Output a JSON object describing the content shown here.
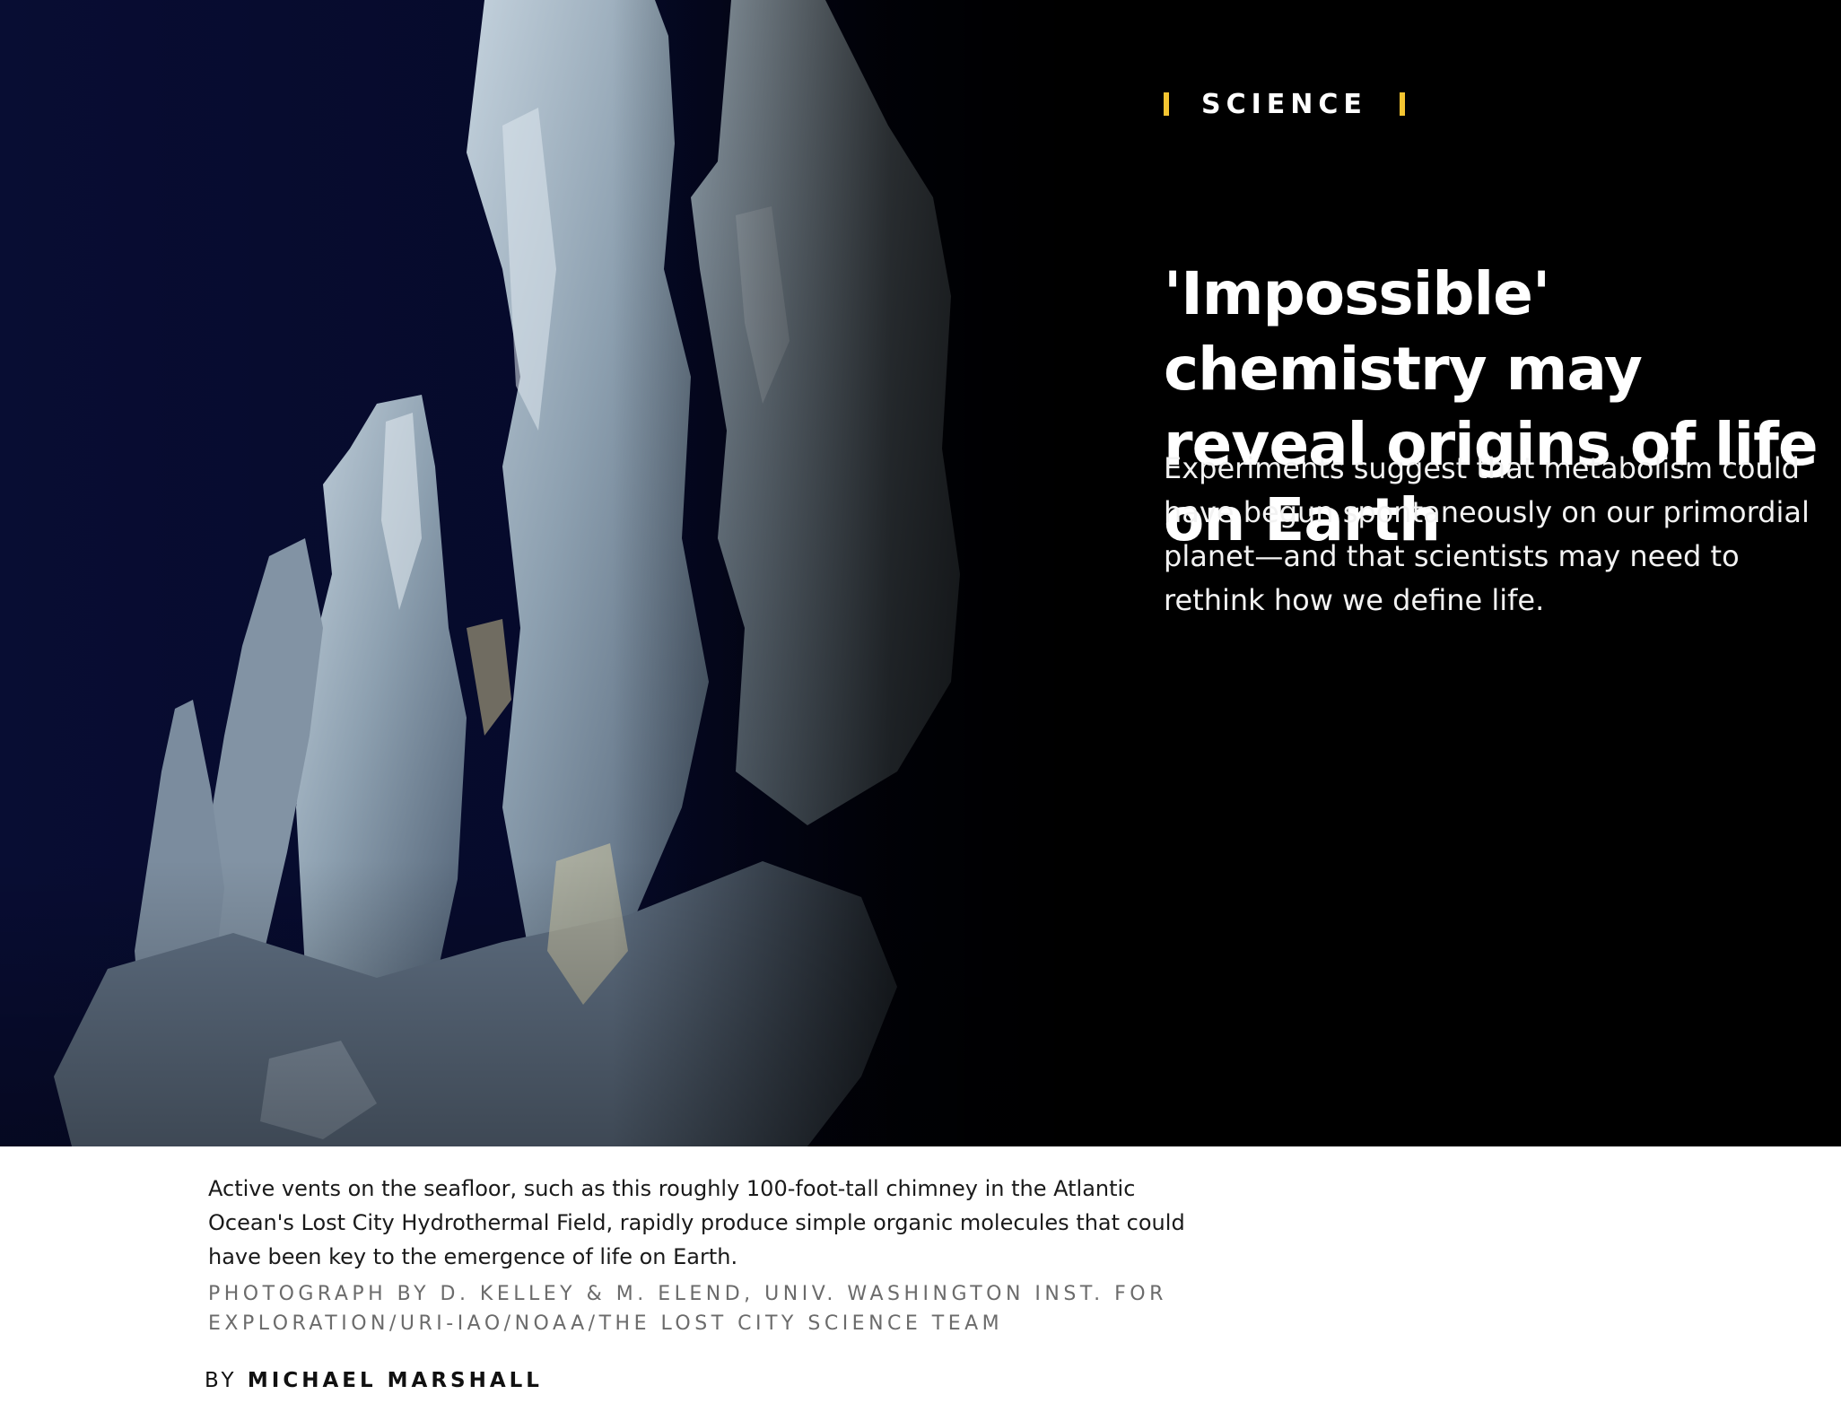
{
  "hero": {
    "kicker": "SCIENCE",
    "headline": "'Impossible' chemistry may reveal origins of life on Earth",
    "dek": "Experiments suggest that metabolism could have begun spontaneously on our primordial planet—and that scientists may need to rethink how we define life.",
    "colors": {
      "background": "#000000",
      "kicker_accent": "#f4c531",
      "photo_water": "#07103a"
    },
    "photo_subject": "hydrothermal-vent-chimney"
  },
  "caption": {
    "text": "Active vents on the seafloor, such as this roughly 100-foot-tall chimney in the Atlantic Ocean's Lost City Hydrothermal Field, rapidly produce simple organic molecules that could have been key to the emergence of life on Earth.",
    "credit": "PHOTOGRAPH BY D. KELLEY & M. ELEND, UNIV. WASHINGTON INST. FOR EXPLORATION/URI-IAO/NOAA/THE LOST CITY SCIENCE TEAM"
  },
  "byline": {
    "prefix": "BY",
    "author": "MICHAEL MARSHALL"
  }
}
